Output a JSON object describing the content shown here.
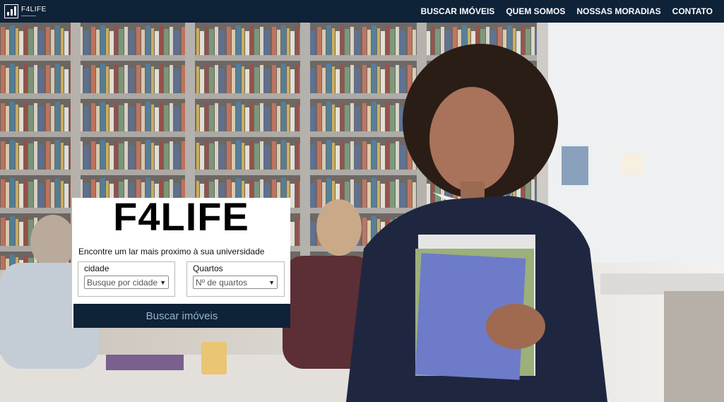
{
  "brand": {
    "name": "F4LIFE",
    "icon": "bar-chart-logo-icon"
  },
  "nav": {
    "links": [
      "BUSCAR IMÓVEIS",
      "QUEM SOMOS",
      "NOSSAS MORADIAS",
      "CONTATO"
    ]
  },
  "search": {
    "title": "F4LIFE",
    "subtitle": "Encontre um lar mais proximo à sua universidade",
    "city": {
      "label": "cidade",
      "selected": "Busque por cidade"
    },
    "rooms": {
      "label": "Quartos",
      "selected": "Nº de quartos"
    },
    "button": "Buscar imóveis"
  },
  "colors": {
    "navbar": "#0e2238",
    "button_bg": "#0e2238",
    "button_text": "#93b4c6"
  }
}
